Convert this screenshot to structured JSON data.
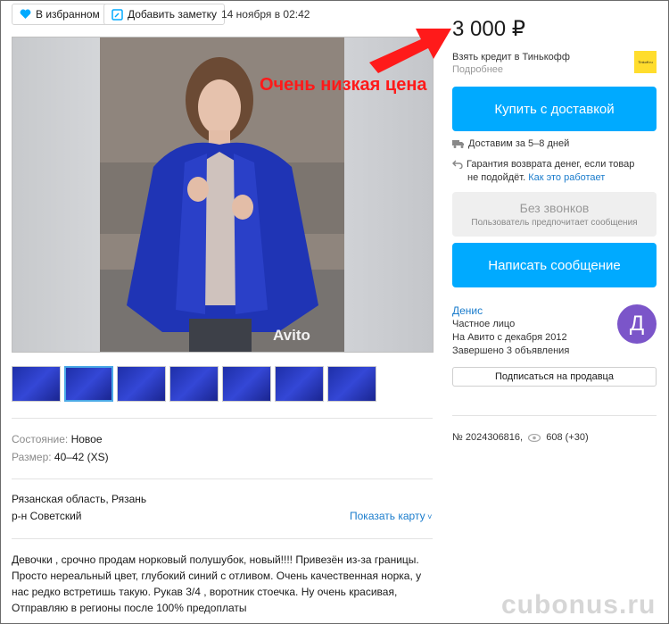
{
  "header": {
    "favorite_label": "В избранном",
    "note_label": "Добавить заметку",
    "date": "14 ноября в 02:42"
  },
  "photo": {
    "watermark": "Avito"
  },
  "annotation": "Очень низкая цена",
  "params": {
    "condition_label": "Состояние:",
    "condition_value": "Новое",
    "size_label": "Размер:",
    "size_value": "40–42 (XS)"
  },
  "location": {
    "region": "Рязанская область, Рязань",
    "district": "р-н Советский",
    "map_link": "Показать карту"
  },
  "description": [
    "Девочки , срочно продам норковый полушубок, новый!!!! Привезён из-за границы.",
    "Просто нереальный цвет, глубокий синий с отливом. Очень качественная норка, у",
    "нас редко встретишь такую. Рукав 3/4 , воротник стоечка. Ну очень красивая,",
    "Отправляю в регионы после 100% предоплаты"
  ],
  "sidebar": {
    "price": "3 000 ₽",
    "credit": "Взять кредит в Тинькофф",
    "credit_more": "Подробнее",
    "bank_logo": "Tinkoff.ru",
    "buy_button": "Купить с доставкой",
    "delivery": "Доставим за 5–8 дней",
    "guarantee_line1": "Гарантия возврата денег, если товар",
    "guarantee_line2": "не подойдёт.",
    "guarantee_link": "Как это работает",
    "no_calls_title": "Без звонков",
    "no_calls_sub": "Пользователь предпочитает сообщения",
    "message_button": "Написать сообщение",
    "seller_name": "Денис",
    "seller_type": "Частное лицо",
    "seller_since": "На Авито с декабря 2012",
    "seller_done": "Завершено 3 объявления",
    "avatar_letter": "Д",
    "subscribe_button": "Подписаться на продавца",
    "ad_number": "№ 2024306816,",
    "views": "608 (+30)"
  },
  "site_watermark": "cubonus.ru",
  "colors": {
    "accent": "#00aaff",
    "avatar": "#7b55c9",
    "annotation": "#ff1a1a"
  }
}
